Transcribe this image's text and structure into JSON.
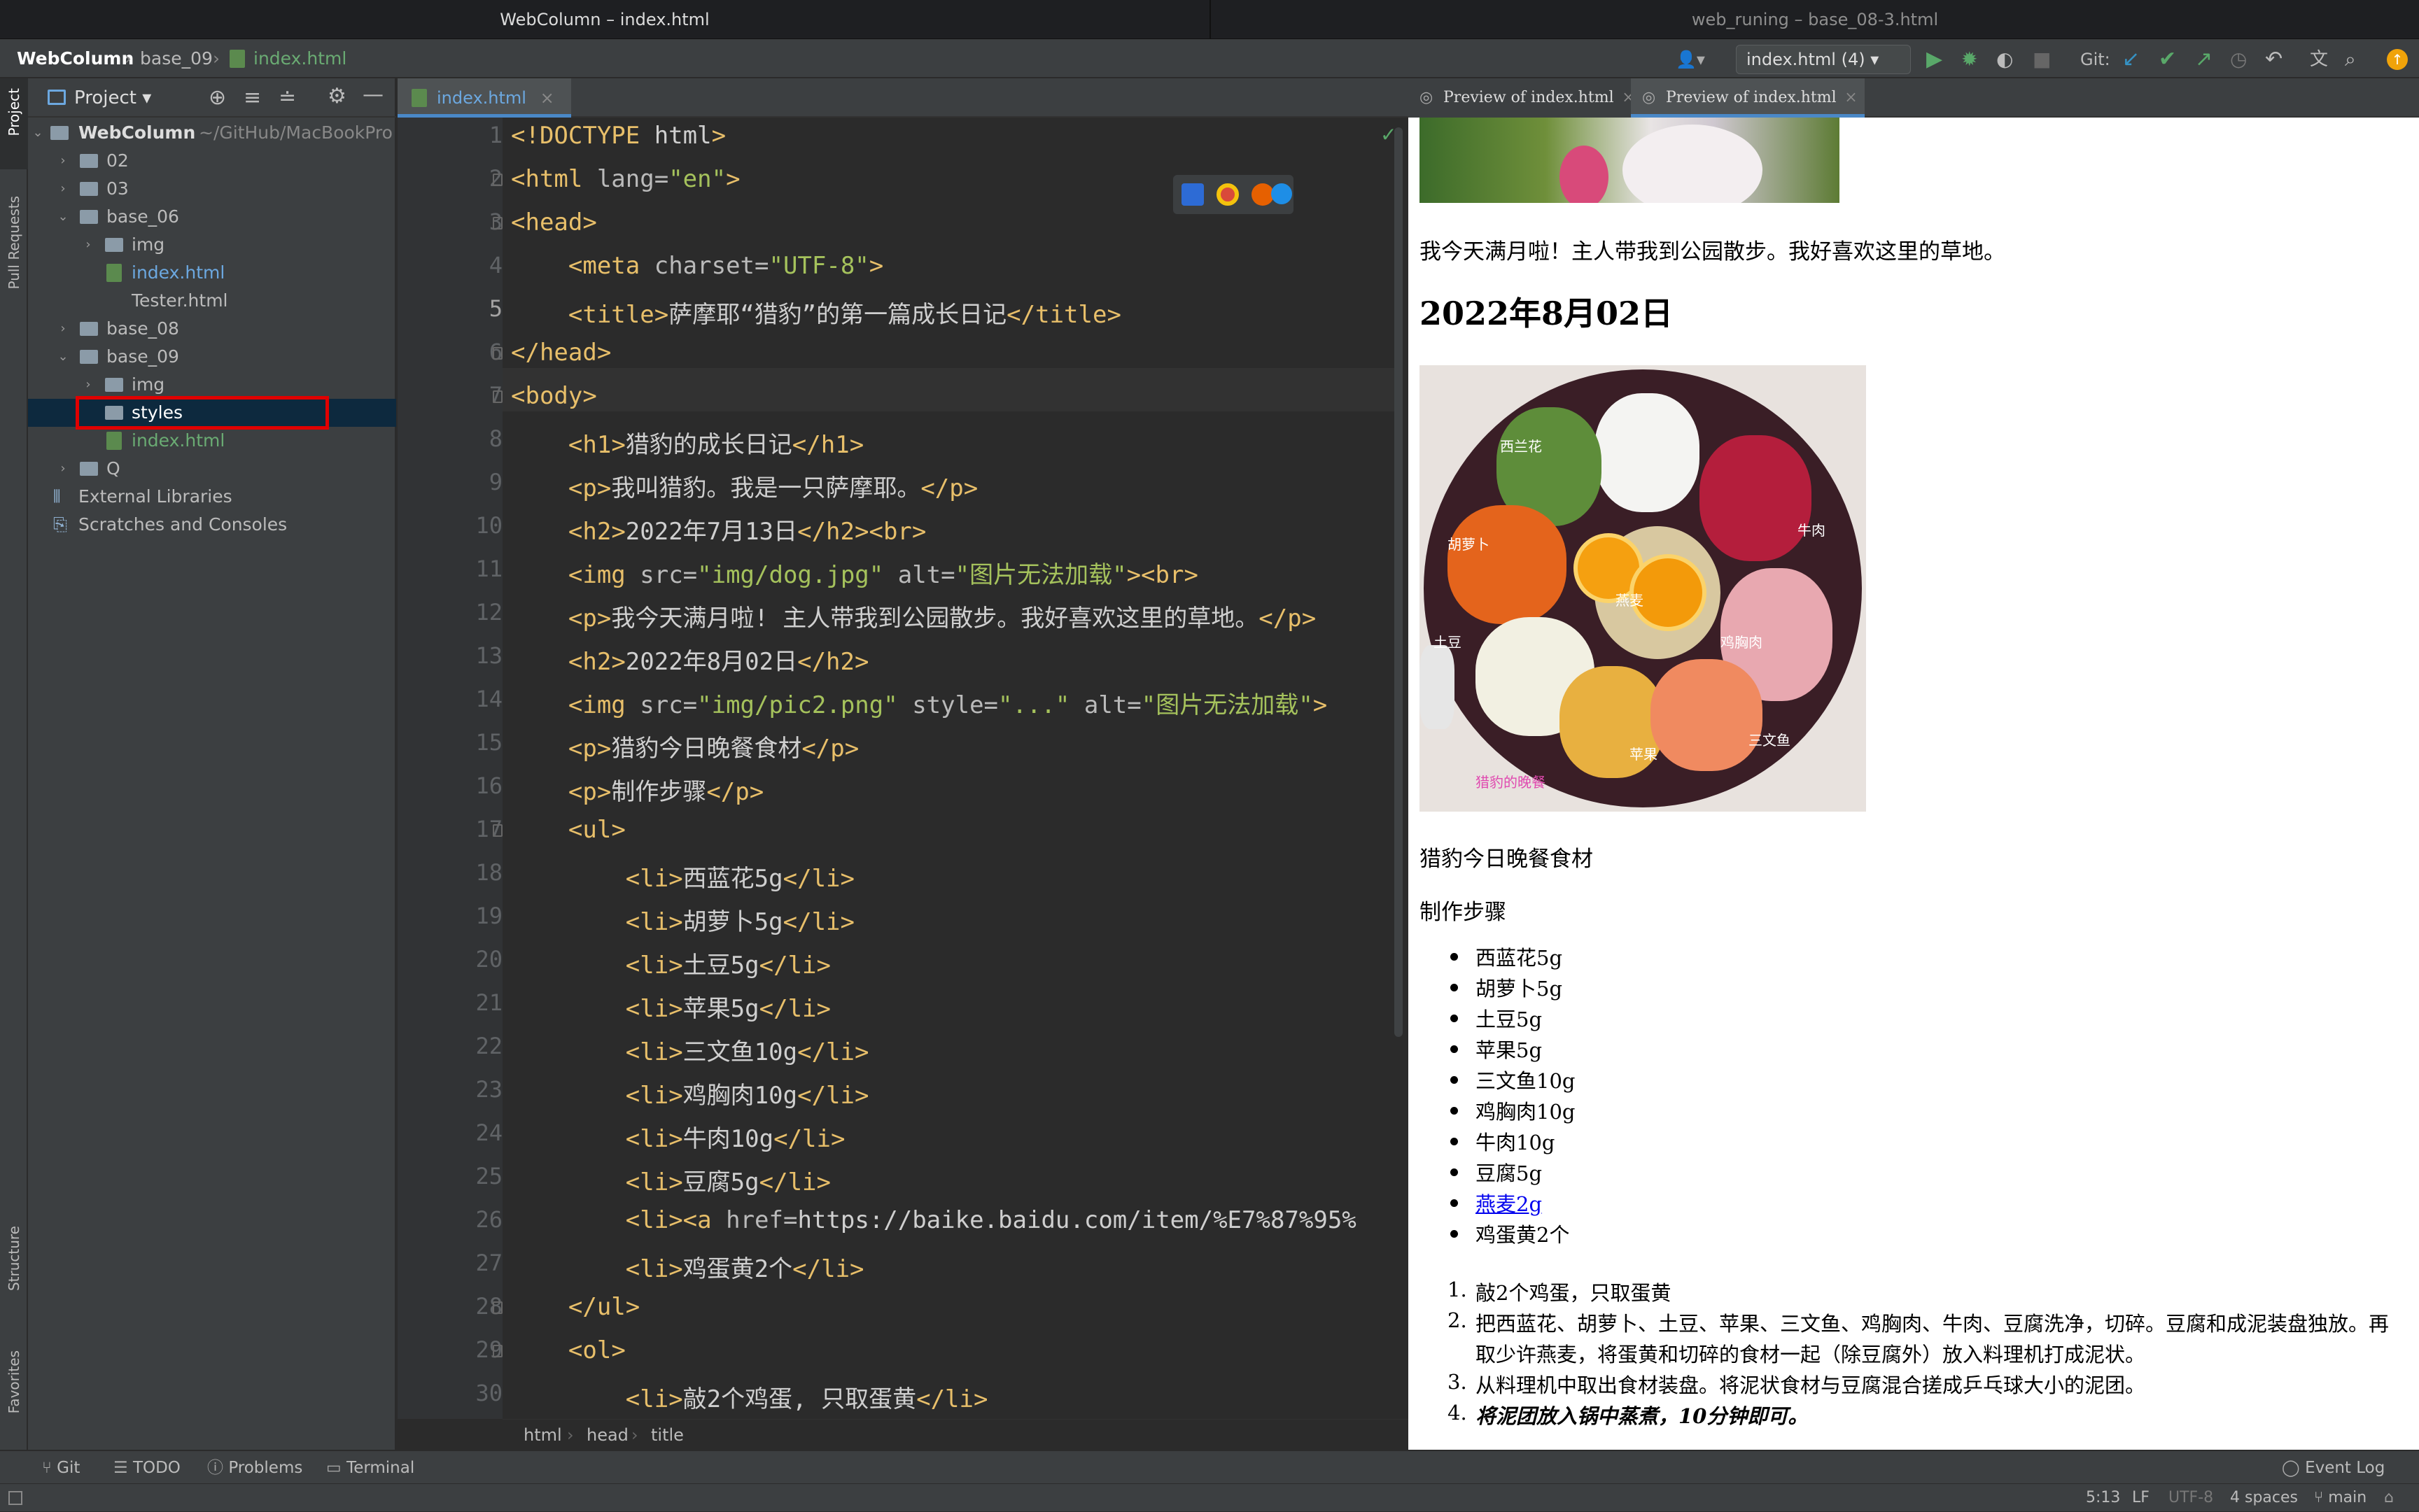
{
  "window": {
    "left_title": "WebColumn – index.html",
    "right_title": "web_runing – base_08-3.html"
  },
  "nav": {
    "project": "WebColumn",
    "folder": "base_09",
    "file": "index.html",
    "run_config": "index.html (4)",
    "git_label": "Git:"
  },
  "stripe": {
    "project": "Project",
    "pull_requests": "Pull Requests",
    "structure": "Structure",
    "favorites": "Favorites"
  },
  "project_panel": {
    "title": "Project",
    "root": "WebColumn",
    "root_path": "~/GitHub/MacBookPro",
    "items": [
      "02",
      "03",
      "base_06",
      "img",
      "index.html",
      "Tester.html",
      "base_08",
      "base_09",
      "img",
      "styles",
      "index.html",
      "Q",
      "External Libraries",
      "Scratches and Consoles"
    ]
  },
  "editor": {
    "tab": "index.html",
    "line_numbers": [
      "1",
      "2",
      "3",
      "4",
      "5",
      "6",
      "7",
      "8",
      "9",
      "10",
      "11",
      "12",
      "13",
      "14",
      "15",
      "16",
      "17",
      "18",
      "19",
      "20",
      "21",
      "22",
      "23",
      "24",
      "25",
      "26",
      "27",
      "28",
      "29",
      "30"
    ],
    "breadcrumb": [
      "html",
      "head",
      "title"
    ],
    "lines": [
      "<!DOCTYPE html>",
      "<html lang=\"en\">",
      "<head>",
      "    <meta charset=\"UTF-8\">",
      "    <title>萨摩耶“猎豹”的第一篇成长日记</title>",
      "</head>",
      "<body>",
      "    <h1>猎豹的成长日记</h1>",
      "    <p>我叫猎豹。我是一只萨摩耶。</p>",
      "    <h2>2022年7月13日</h2><br>",
      "    <img src=\"img/dog.jpg\" alt=\"图片无法加载\"><br>",
      "    <p>我今天满月啦! 主人带我到公园散步。我好喜欢这里的草地。</p>",
      "    <h2>2022年8月02日</h2>",
      "    <img src=\"img/pic2.png\" style=\"...\" alt=\"图片无法加载\">",
      "    <p>猎豹今日晚餐食材</p>",
      "    <p>制作步骤</p>",
      "    <ul>",
      "        <li>西蓝花5g</li>",
      "        <li>胡萝卜5g</li>",
      "        <li>土豆5g</li>",
      "        <li>苹果5g</li>",
      "        <li>三文鱼10g</li>",
      "        <li>鸡胸肉10g</li>",
      "        <li>牛肉10g</li>",
      "        <li>豆腐5g</li>",
      "        <li><a href=\"https://baike.baidu.com/item/%E7%87%95%",
      "        <li>鸡蛋黄2个</li>",
      "    </ul>",
      "    <ol>",
      "        <li>敲2个鸡蛋, 只取蛋黄</li>"
    ]
  },
  "preview": {
    "tabs": [
      "Preview of index.html",
      "Preview of index.html"
    ],
    "para1": "我今天满月啦！主人带我到公园散步。我好喜欢这里的草地。",
    "h2": "2022年8月02日",
    "dish_labels": [
      "西兰花",
      "牛肉",
      "胡萝卜",
      "苹果",
      "三文鱼",
      "土豆",
      "鸡胸肉",
      "燕麦",
      "猎豹的晚餐"
    ],
    "para2": "猎豹今日晚餐食材",
    "para3": "制作步骤",
    "ul": [
      "西蓝花5g",
      "胡萝卜5g",
      "土豆5g",
      "苹果5g",
      "三文鱼10g",
      "鸡胸肉10g",
      "牛肉10g",
      "豆腐5g",
      "燕麦2g",
      "鸡蛋黄2个"
    ],
    "ol": [
      "敲2个鸡蛋，只取蛋黄",
      "把西蓝花、胡萝卜、土豆、苹果、三文鱼、鸡胸肉、牛肉、豆腐洗净，切碎。豆腐和成泥装盘独放。再取少许燕麦，将蛋黄和切碎的食材一起（除豆腐外）放入料理机打成泥状。",
      "从料理机中取出食材装盘。将泥状食材与豆腐混合搓成乒乓球大小的泥团。",
      "将泥团放入锅中蒸煮，10分钟即可。"
    ],
    "ol_nums": [
      "1.",
      "2.",
      "3.",
      "4."
    ]
  },
  "bottom": {
    "git": "Git",
    "todo": "TODO",
    "problems": "Problems",
    "terminal": "Terminal",
    "event_log": "Event Log"
  },
  "status": {
    "pos": "5:13",
    "lf": "LF",
    "enc": "UTF-8",
    "indent": "4 spaces",
    "branch": "main"
  }
}
